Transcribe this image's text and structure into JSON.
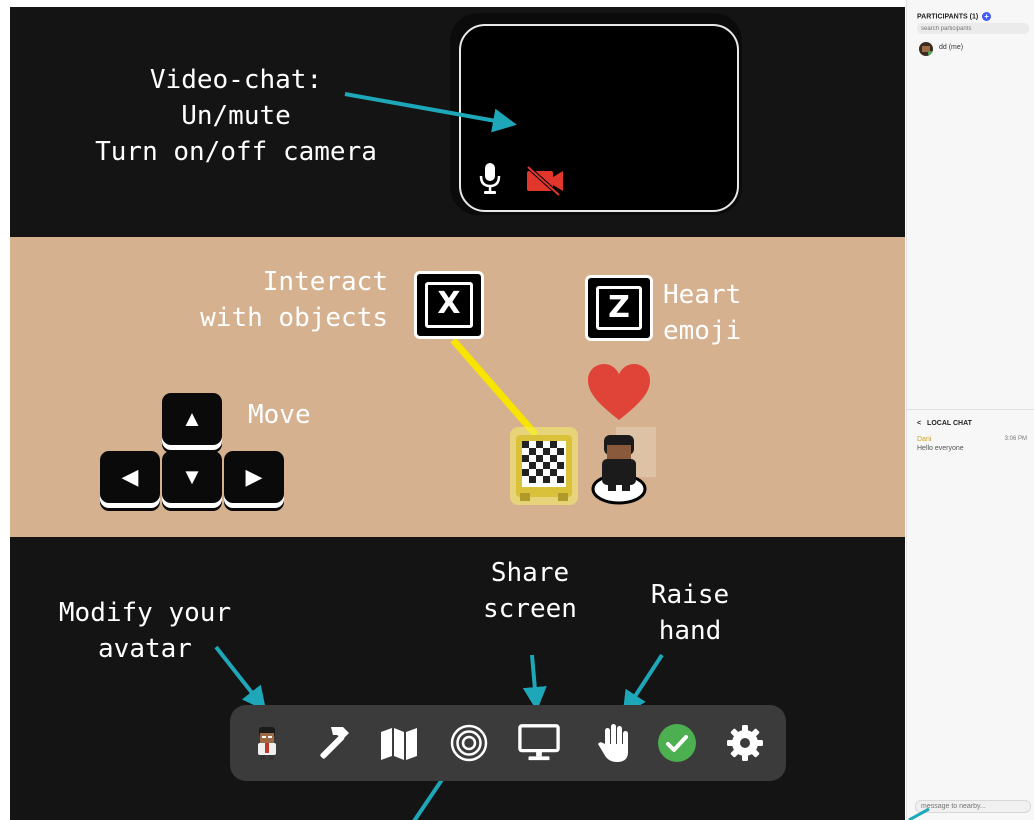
{
  "annotations": {
    "video_chat": [
      "Video-chat:",
      "Un/mute",
      "Turn on/off camera"
    ],
    "interact": [
      "Interact",
      "with objects"
    ],
    "heart": [
      "Heart",
      "emoji"
    ],
    "move": "Move",
    "modify_avatar": [
      "Modify your",
      "avatar"
    ],
    "share_screen": [
      "Share",
      "screen"
    ],
    "raise_hand": [
      "Raise",
      "hand"
    ]
  },
  "keys": {
    "interact": "X",
    "heart": "Z"
  },
  "arrow_keys": {
    "up": "▲",
    "left": "◀",
    "down": "▼",
    "right": "▶"
  },
  "video": {
    "mic_icon": "microphone-icon",
    "camera_icon": "camera-off-icon"
  },
  "toolbar": {
    "items": [
      "avatar-icon",
      "hammer-icon",
      "map-icon",
      "target-icon",
      "monitor-icon",
      "hand-icon",
      "check-icon",
      "gear-icon"
    ]
  },
  "sidebar": {
    "participants_header": "PARTICIPANTS (1)",
    "search_placeholder": "search participants",
    "participants": [
      {
        "name": "dd (me)"
      }
    ],
    "local_chat_header": "LOCAL CHAT",
    "messages": [
      {
        "sender": "Dani",
        "time": "3:06 PM",
        "text": "Hello everyone"
      }
    ],
    "message_placeholder": "message to nearby..."
  },
  "colors": {
    "annotation_arrow": "#1ea7b8",
    "mid_band": "#d5b18f",
    "heart": "#e04438",
    "link_line": "#f7e400",
    "camera_off": "#e0362c",
    "check_green": "#4caf50",
    "sidebar_accent": "#3d5afe",
    "chat_sender": "#c9a227"
  }
}
